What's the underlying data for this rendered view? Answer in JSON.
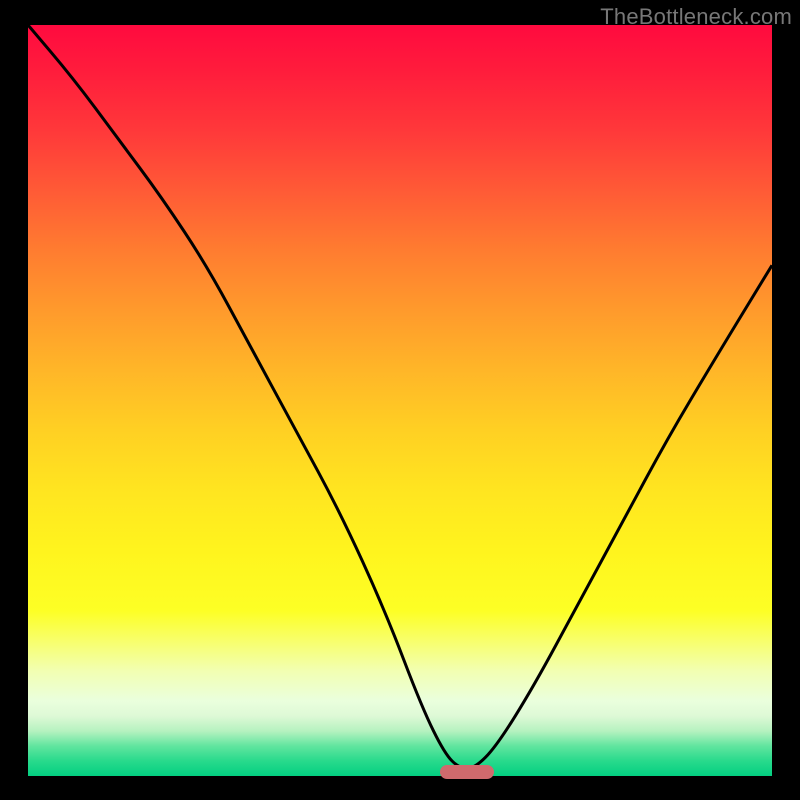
{
  "attribution": "TheBottleneck.com",
  "colors": {
    "frame": "#000000",
    "curve": "#000000",
    "marker": "#d06a6d",
    "gradient_top": "#ff0a3f",
    "gradient_bottom": "#03cf81"
  },
  "chart_data": {
    "type": "line",
    "title": "",
    "xlabel": "",
    "ylabel": "",
    "xlim": [
      0,
      100
    ],
    "ylim": [
      0,
      100
    ],
    "x": [
      0,
      6,
      12,
      18,
      24,
      30,
      36,
      42,
      48,
      53,
      56,
      58,
      60,
      63,
      68,
      74,
      80,
      86,
      92,
      100
    ],
    "values": [
      100,
      93,
      85,
      77,
      68,
      57,
      46,
      35,
      22,
      9,
      3,
      1,
      1,
      4,
      12,
      23,
      34,
      45,
      55,
      68
    ],
    "marker": {
      "x": 59,
      "y": 0.5
    },
    "notes": "x is normalized horizontal position (0-100, left to right); values are height from the bottom green band (0) to the top (100). Curve is a V-shaped bottleneck profile with minimum near x≈58-60."
  }
}
